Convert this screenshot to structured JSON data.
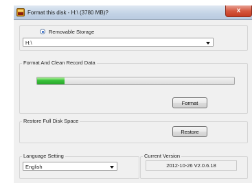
{
  "window": {
    "title": "Format this disk - H:\\ (3780 MB)?",
    "close_label": "x"
  },
  "storage": {
    "radio_label": "Removable Storage",
    "selected_drive": "H:\\"
  },
  "format_section": {
    "title": "Format And Clean Record Data",
    "progress_fraction": 0.14,
    "button_label": "Format"
  },
  "restore_section": {
    "title": "Restore Full Disk Space",
    "button_label": "Restore"
  },
  "language": {
    "title": "Language Setting",
    "selected": "English"
  },
  "version": {
    "title": "Current Version",
    "value": "2012-10-26 V2.0.6.18"
  },
  "colors": {
    "progress_fill": "#39c13a",
    "close_button": "#c43c22"
  }
}
